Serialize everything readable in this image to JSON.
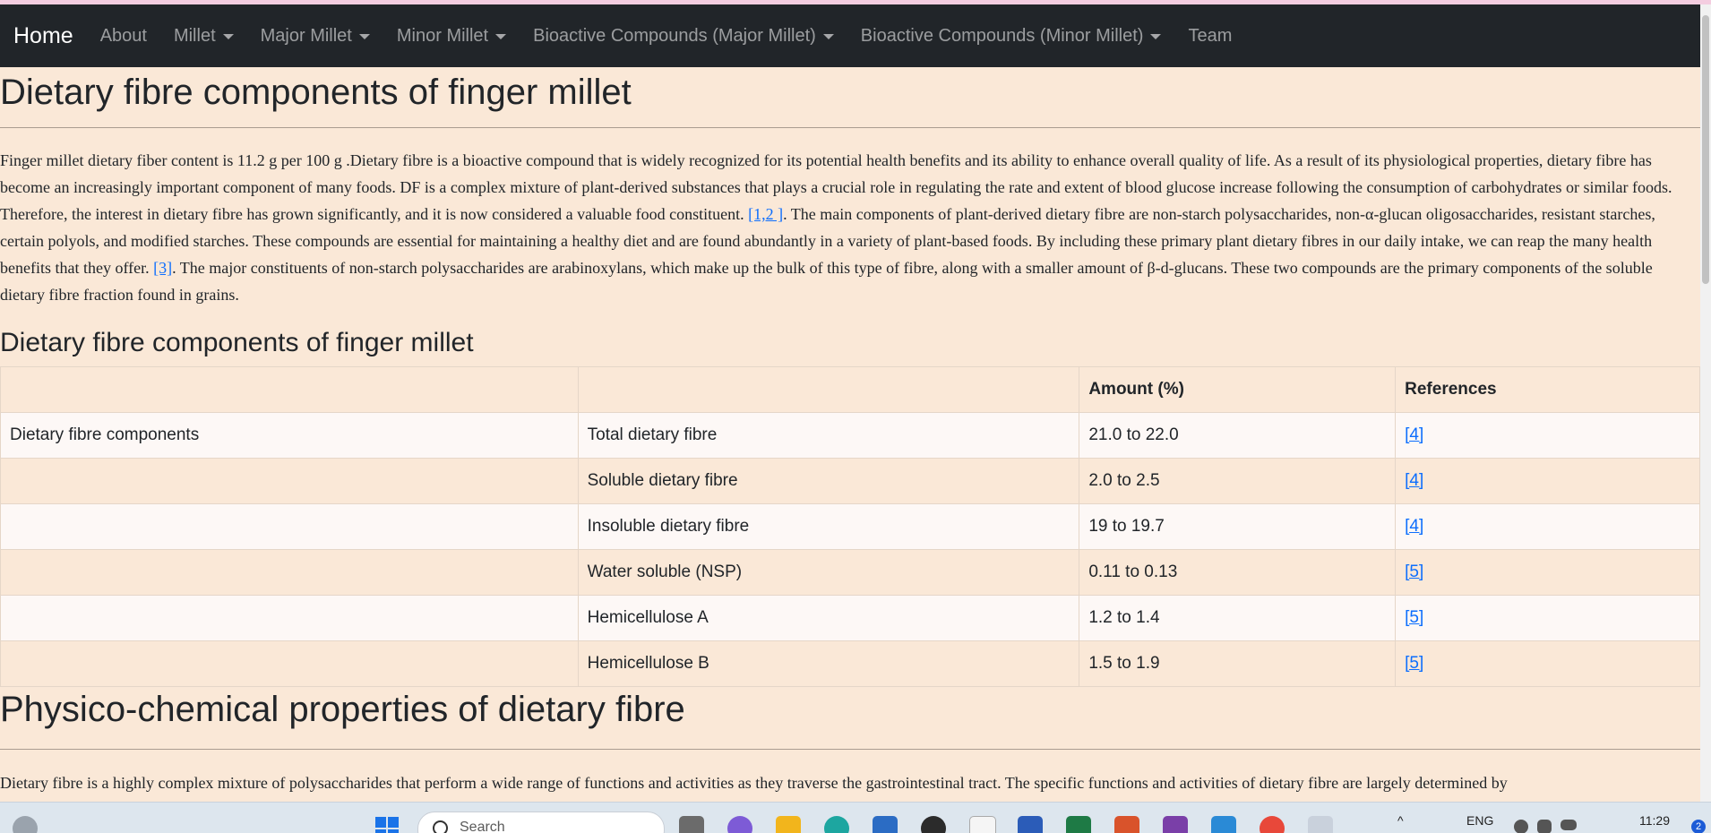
{
  "navbar": {
    "brand": "Home",
    "items": [
      {
        "label": "About",
        "dropdown": false
      },
      {
        "label": "Millet",
        "dropdown": true
      },
      {
        "label": "Major Millet",
        "dropdown": true
      },
      {
        "label": "Minor Millet",
        "dropdown": true
      },
      {
        "label": "Bioactive Compounds (Major Millet)",
        "dropdown": true
      },
      {
        "label": "Bioactive Compounds (Minor Millet)",
        "dropdown": true
      },
      {
        "label": "Team",
        "dropdown": false
      }
    ]
  },
  "page_title": "Dietary fibre components of finger millet",
  "intro": {
    "text1": "Finger millet dietary fiber content is 11.2 g per 100 g .Dietary fibre is a bioactive compound that is widely recognized for its potential health benefits and its ability to enhance overall quality of life. As a result of its physiological properties, dietary fibre has become an increasingly important component of many foods. DF is a complex mixture of plant-derived substances that plays a crucial role in regulating the rate and extent of blood glucose increase following the consumption of carbohydrates or similar foods. Therefore, the interest in dietary fibre has grown significantly, and it is now considered a valuable food constituent. ",
    "ref1": "[1,2 ]",
    "text2": ". The main components of plant-derived dietary fibre are non-starch polysaccharides, non-α-glucan oligosaccharides, resistant starches, certain polyols, and modified starches. These compounds are essential for maintaining a healthy diet and are found abundantly in a variety of plant-based foods. By including these primary plant dietary fibres in our daily intake, we can reap the many health benefits that they offer. ",
    "ref2": "[3]",
    "text3": ". The major constituents of non-starch polysaccharides are arabinoxylans, which make up the bulk of this type of fibre, along with a smaller amount of β-d-glucans. These two compounds are the primary components of the soluble dietary fibre fraction found in grains."
  },
  "table_title": "Dietary fibre components of finger millet",
  "table": {
    "headers": [
      "",
      "",
      "Amount (%)",
      "References"
    ],
    "rows": [
      {
        "group": "Dietary fibre components",
        "component": "Total dietary fibre",
        "amount": "21.0 to 22.0",
        "ref": "[4]"
      },
      {
        "group": "",
        "component": "Soluble dietary fibre",
        "amount": "2.0 to 2.5",
        "ref": "[4]"
      },
      {
        "group": "",
        "component": "Insoluble dietary fibre",
        "amount": "19 to 19.7",
        "ref": "[4]"
      },
      {
        "group": "",
        "component": "Water soluble (NSP)",
        "amount": "0.11 to 0.13",
        "ref": "[5]"
      },
      {
        "group": "",
        "component": "Hemicellulose A",
        "amount": "1.2 to 1.4",
        "ref": "[5]"
      },
      {
        "group": "",
        "component": "Hemicellulose B",
        "amount": "1.5 to 1.9",
        "ref": "[5]"
      }
    ]
  },
  "section2": {
    "title": "Physico-chemical properties of dietary fibre",
    "text": "Dietary fibre is a highly complex mixture of polysaccharides that perform a wide range of functions and activities as they traverse the gastrointestinal tract. The specific functions and activities of dietary fibre are largely determined by"
  },
  "taskbar": {
    "search_placeholder": "Search",
    "language": "ENG",
    "time": "11:29",
    "notification_count": "2"
  }
}
